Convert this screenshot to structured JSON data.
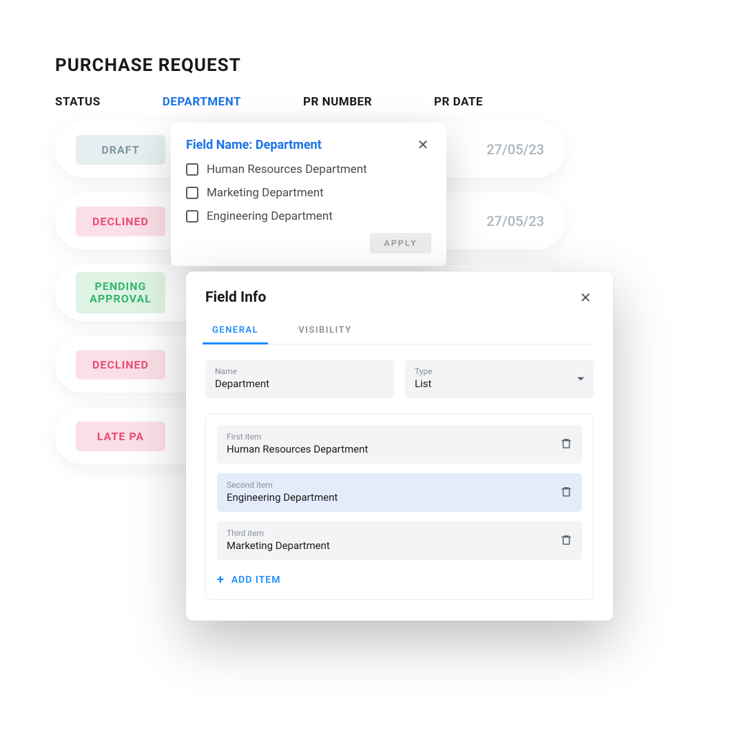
{
  "page": {
    "title": "PURCHASE REQUEST",
    "columns": [
      "STATUS",
      "DEPARTMENT",
      "PR NUMBER",
      "PR DATE"
    ],
    "active_column_index": 1,
    "rows": [
      {
        "status": "DRAFT",
        "badge_class": "badge-draft",
        "date": "27/05/23"
      },
      {
        "status": "DECLINED",
        "badge_class": "badge-declined",
        "date": "27/05/23"
      },
      {
        "status": "PENDING\nAPPROVAL",
        "badge_class": "badge-pending",
        "date": ""
      },
      {
        "status": "DECLINED",
        "badge_class": "badge-declined",
        "date": ""
      },
      {
        "status": "LATE PA",
        "badge_class": "badge-late",
        "date": ""
      }
    ]
  },
  "filter": {
    "title": "Field Name: Department",
    "options": [
      "Human Resources Department",
      "Marketing Department",
      "Engineering Department"
    ],
    "apply_label": "APPLY"
  },
  "modal": {
    "title": "Field Info",
    "tabs": [
      "GENERAL",
      "VISIBILITY"
    ],
    "active_tab_index": 0,
    "name_label": "Name",
    "name_value": "Department",
    "type_label": "Type",
    "type_value": "List",
    "items": [
      {
        "label": "First item",
        "value": "Human Resources Department",
        "selected": false
      },
      {
        "label": "Second item",
        "value": "Engineering Department",
        "selected": true
      },
      {
        "label": "Third item",
        "value": "Marketing Department",
        "selected": false
      }
    ],
    "add_item_label": "ADD ITEM"
  }
}
